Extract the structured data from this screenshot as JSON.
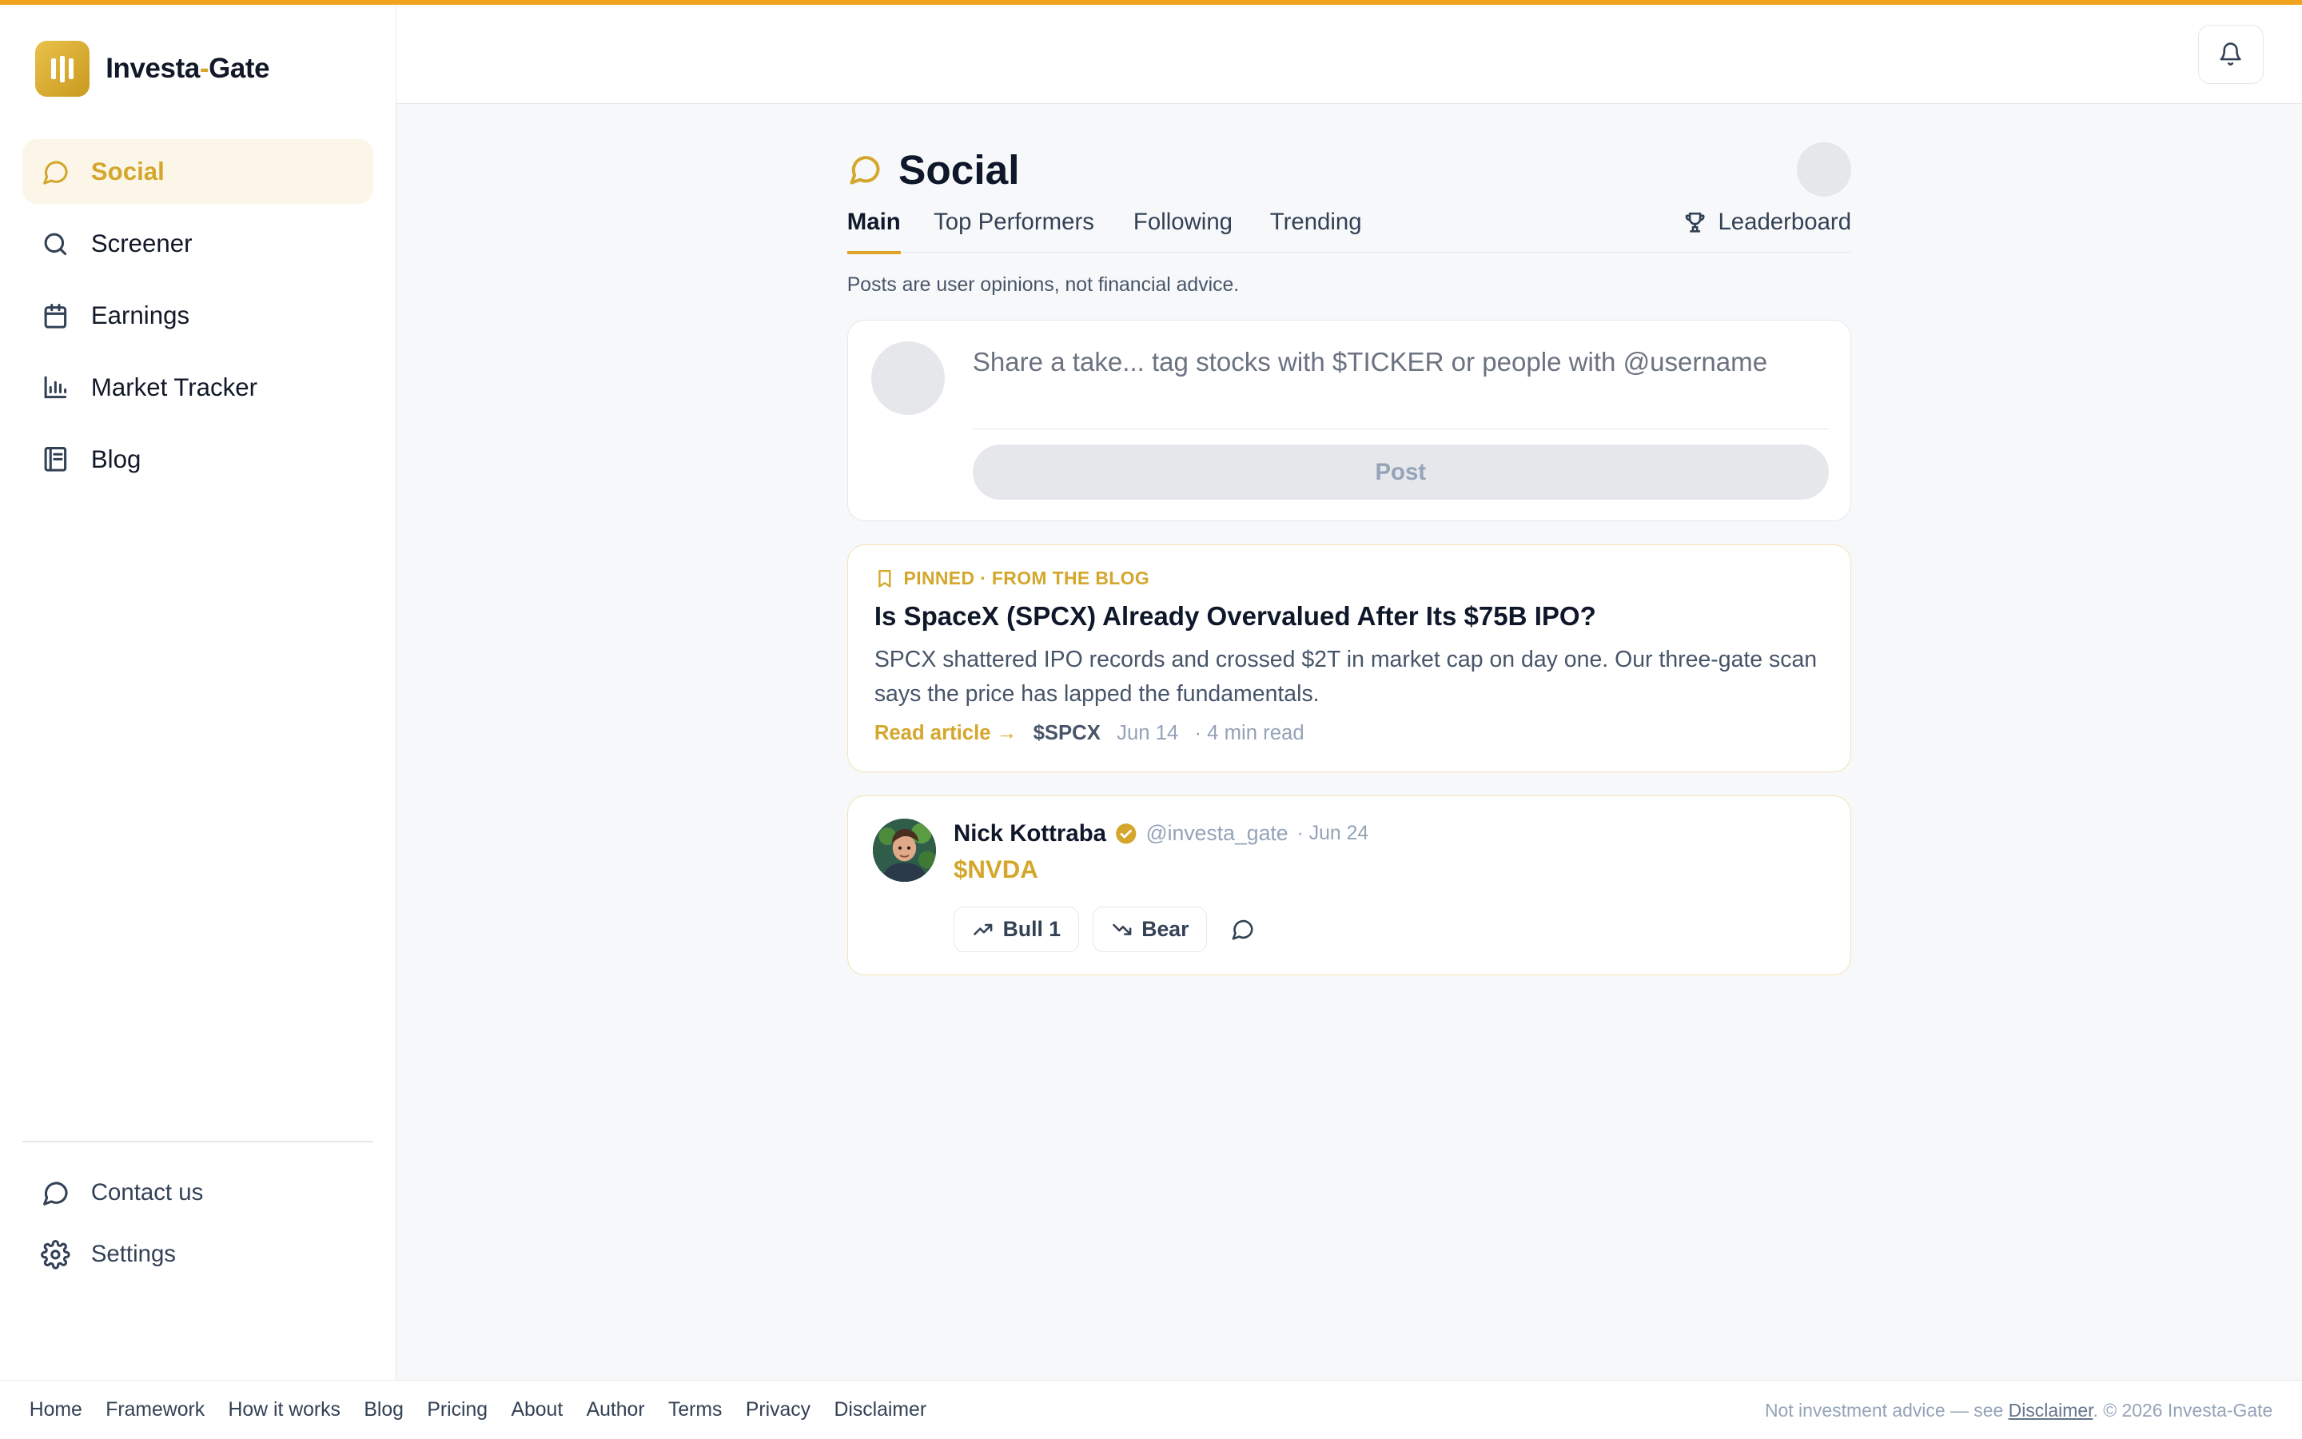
{
  "brand": {
    "name_part1": "Investa",
    "dash": "-",
    "name_part2": "Gate"
  },
  "colors": {
    "accent": "#d4a72c",
    "top_bar": "#f0a31c",
    "text": "#0f172a",
    "muted": "#94a3b8"
  },
  "sidebar": {
    "items": [
      {
        "label": "Social",
        "icon": "chat-bubble-icon",
        "active": true
      },
      {
        "label": "Screener",
        "icon": "search-icon"
      },
      {
        "label": "Earnings",
        "icon": "calendar-icon"
      },
      {
        "label": "Market Tracker",
        "icon": "bar-chart-icon"
      },
      {
        "label": "Blog",
        "icon": "book-icon"
      }
    ],
    "bottom": [
      {
        "label": "Contact us",
        "icon": "chat-bubble-icon"
      },
      {
        "label": "Settings",
        "icon": "gear-icon"
      }
    ]
  },
  "header": {
    "bell_icon": "bell-icon"
  },
  "page": {
    "title": "Social",
    "tabs": [
      "Main",
      "Top Performers",
      "Following",
      "Trending"
    ],
    "active_tab": "Main",
    "leaderboard_label": "Leaderboard",
    "disclaimer": "Posts are user opinions, not financial advice."
  },
  "composer": {
    "placeholder": "Share a take... tag stocks with $TICKER or people with @username",
    "post_label": "Post"
  },
  "pinned": {
    "label": "PINNED · FROM THE BLOG",
    "title": "Is SpaceX (SPCX) Already Overvalued After Its $75B IPO?",
    "excerpt": "SPCX shattered IPO records and crossed $2T in market cap on day one. Our three-gate scan says the price has lapped the fundamentals.",
    "read_label": "Read article →",
    "ticker": "$SPCX",
    "date": "Jun 14",
    "read_time": "· 4 min read"
  },
  "post": {
    "author": "Nick Kottraba",
    "handle": "@investa_gate",
    "date": "· Jun 24",
    "ticker": "$NVDA",
    "bull_label": "Bull 1",
    "bear_label": "Bear"
  },
  "footer": {
    "links": [
      "Home",
      "Framework",
      "How it works",
      "Blog",
      "Pricing",
      "About",
      "Author",
      "Terms",
      "Privacy",
      "Disclaimer"
    ],
    "note_prefix": "Not investment advice — see ",
    "note_link": "Disclaimer",
    "note_suffix": ". © 2026 Investa-Gate"
  }
}
